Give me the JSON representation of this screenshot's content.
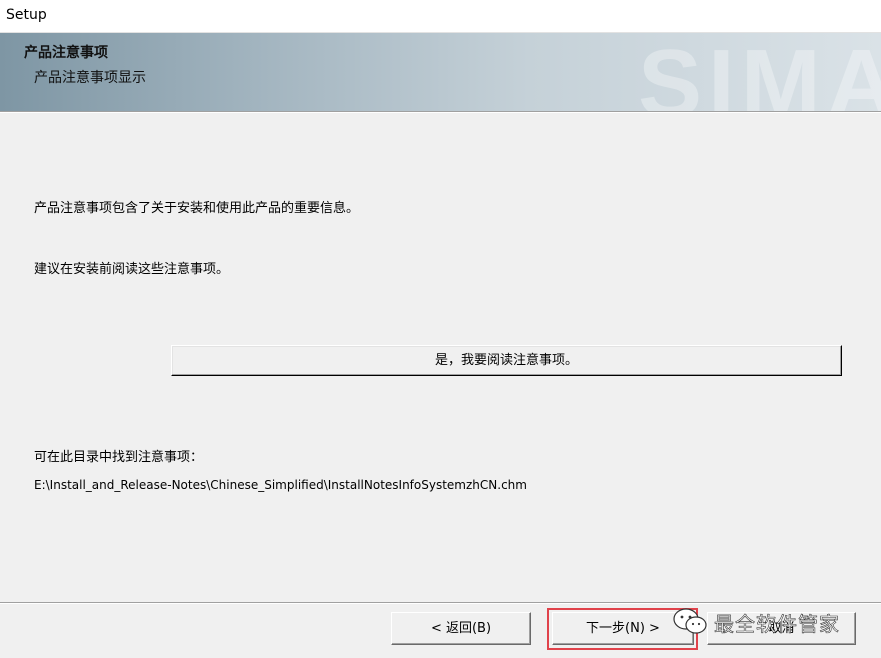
{
  "window": {
    "title": "Setup"
  },
  "header": {
    "title": "产品注意事项",
    "subtitle": "产品注意事项显示",
    "watermark": "SIMA"
  },
  "content": {
    "line1": "产品注意事项包含了关于安装和使用此产品的重要信息。",
    "line2": "建议在安装前阅读这些注意事项。",
    "read_button": "是，我要阅读注意事项。",
    "location_label": "可在此目录中找到注意事项：",
    "location_path": "E:\\Install_and_Release-Notes\\Chinese_Simplified\\InstallNotesInfoSystemzhCN.chm"
  },
  "footer": {
    "back_label": "< 返回(B)",
    "next_label": "下一步(N) >",
    "cancel_label": "取消"
  },
  "overlay": {
    "watermark_text": "最全软件管家"
  },
  "colors": {
    "highlight": "#e0424b",
    "header_gradient_start": "#7e96a4",
    "header_gradient_end": "#dae2e7",
    "dialog_bg": "#f0f0f0"
  }
}
